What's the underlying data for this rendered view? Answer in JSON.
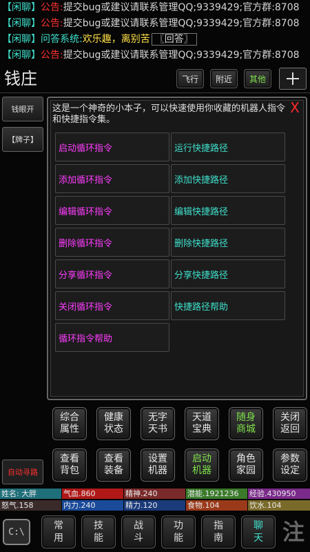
{
  "chat": [
    {
      "channel": "【闲聊】",
      "tag": "公告:",
      "text": "提交bug或建议请联系管理QQ;9339429;官方群:8708"
    },
    {
      "channel": "【闲聊】",
      "tag": "公告:",
      "text": "提交bug或建议请联系管理QQ;9339429;官方群:8708"
    },
    {
      "channel": "【闲聊】",
      "tag": "问答系统:",
      "text": "欢乐趣，离别苦",
      "link": "〖回答〗"
    },
    {
      "channel": "【闲聊】",
      "tag": "公告:",
      "text": "提交bug或建议请联系管理QQ;9339429;官方群:8708"
    }
  ],
  "location": "钱庄",
  "top_buttons": {
    "fly": "飞行",
    "nearby": "附近",
    "other": "其他"
  },
  "side_buttons": {
    "bank": "钱眼开",
    "sign": "【牌子】"
  },
  "panel": {
    "description": "这是一个神奇的小本子，可以快速使用你收藏的机器人指令和快捷指令集。",
    "close": "X",
    "left_commands": [
      "启动循环指令",
      "添加循环指令",
      "编辑循环指令",
      "删除循环指令",
      "分享循环指令",
      "关闭循环指令",
      "循环指令帮助"
    ],
    "right_commands": [
      "运行快捷路径",
      "添加快捷路径",
      "编辑快捷路径",
      "删除快捷路径",
      "分享快捷路径",
      "快捷路径帮助"
    ]
  },
  "grid_row1": [
    "综合\n属性",
    "健康\n状态",
    "无字\n天书",
    "天道\n宝典",
    "随身\n商城",
    "关闭\n返回"
  ],
  "grid_row2": [
    "查看\n背包",
    "查看\n装备",
    "设置\n机器",
    "启动\n机器",
    "角色\n家园",
    "参数\n设定"
  ],
  "auto_path": "自动寻路",
  "stats": {
    "name": "姓名: 大胖",
    "hp": "气血.860",
    "spirit": "精神.240",
    "potential": "潜能.1921236",
    "exp": "经验.430950",
    "rage": "怒气.158",
    "neili": "内力.240",
    "energy": "精力.120",
    "food": "食物.104",
    "water": "饮水.104"
  },
  "bottom_nav": [
    "常\n用",
    "技\n能",
    "战\n斗",
    "功\n能",
    "指\n南",
    "聊\n天"
  ],
  "corner_left": "C:\\",
  "corner_right": "注"
}
